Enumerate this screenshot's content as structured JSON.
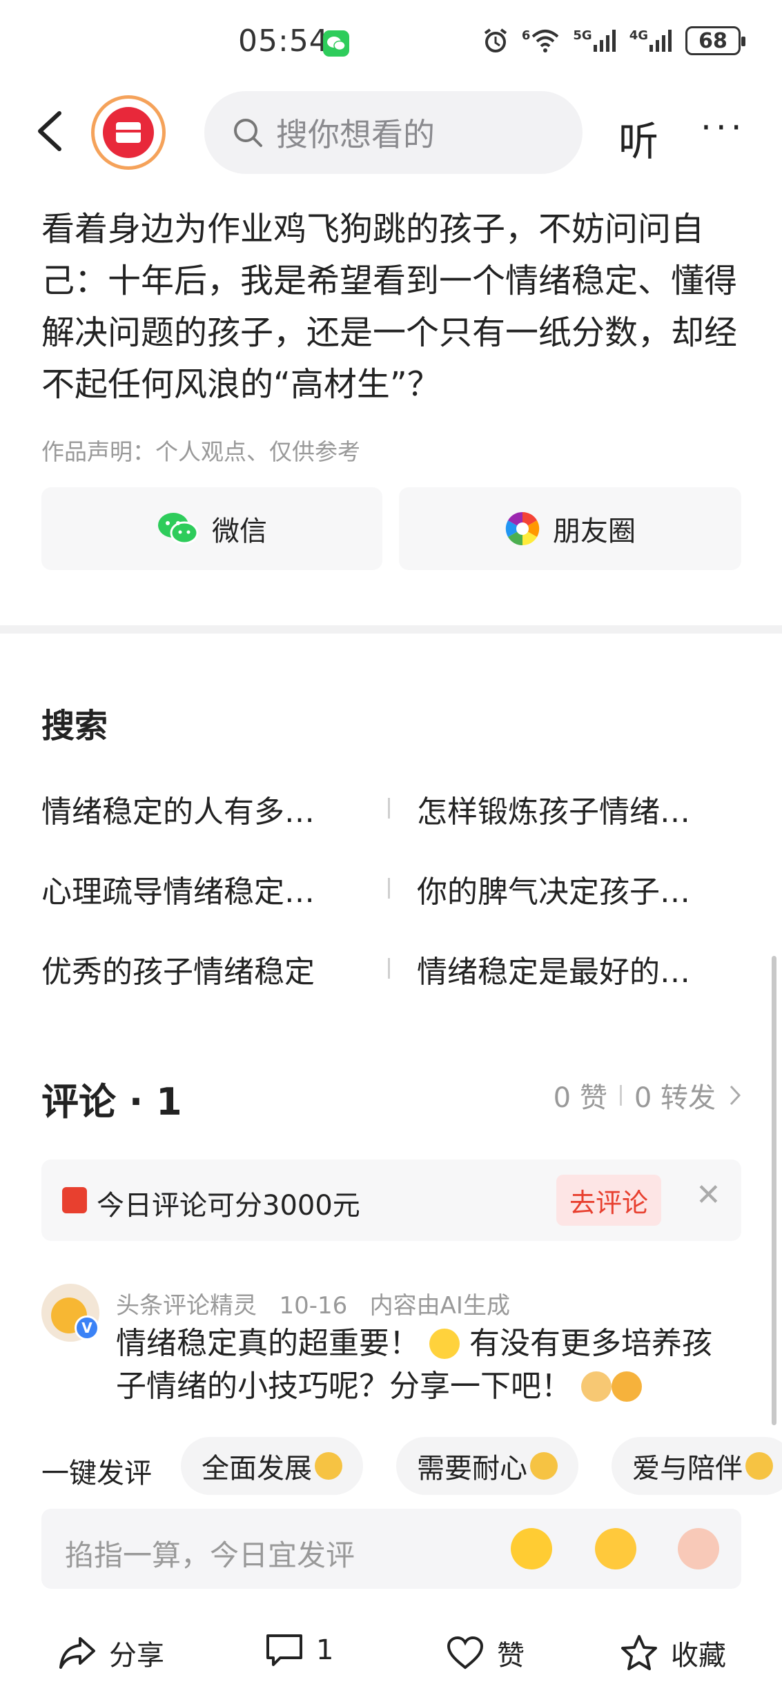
{
  "status_bar": {
    "time": "05:54",
    "network_labels": [
      "6",
      "5G",
      "4G"
    ],
    "battery": "68"
  },
  "top_nav": {
    "search_placeholder": "搜你想看的",
    "listen_label": "听",
    "more_label": "···"
  },
  "article": {
    "body": "看着身边为作业鸡飞狗跳的孩子，不妨问问自己：十年后，我是希望看到一个情绪稳定、懂得解决问题的孩子，还是一个只有一纸分数，却经不起任何风浪的“高材生”？",
    "declaration": "作品声明：个人观点、仅供参考"
  },
  "share": {
    "wechat_label": "微信",
    "moments_label": "朋友圈"
  },
  "search_section": {
    "title": "搜索",
    "suggestions": [
      "情绪稳定的人有多…",
      "怎样锻炼孩子情绪…",
      "心理疏导情绪稳定…",
      "你的脾气决定孩子…",
      "优秀的孩子情绪稳定",
      "情绪稳定是最好的…"
    ]
  },
  "comments": {
    "title": "评论 · 1",
    "likes": "0 赞",
    "reposts": "0 转发",
    "promo_text": "今日评论可分3000元",
    "promo_button": "去评论",
    "items": [
      {
        "author": "头条评论精灵",
        "date": "10-16",
        "tag": "内容由AI生成",
        "text_part1": "情绪稳定真的超重要！",
        "text_part2": "有没有更多培养孩子情绪的小技巧呢？分享一下吧！"
      }
    ]
  },
  "quick_reply": {
    "label": "一键发评",
    "chips": [
      "全面发展",
      "需要耐心",
      "爱与陪伴"
    ]
  },
  "input": {
    "placeholder": "掐指一算，今日宜发评"
  },
  "bottom_bar": {
    "share": "分享",
    "comment_count": "1",
    "like": "赞",
    "favorite": "收藏"
  },
  "colors": {
    "brand_red": "#e8402f",
    "wechat_green": "#2ecc5b",
    "text_primary": "#222222",
    "text_secondary": "#999999"
  }
}
